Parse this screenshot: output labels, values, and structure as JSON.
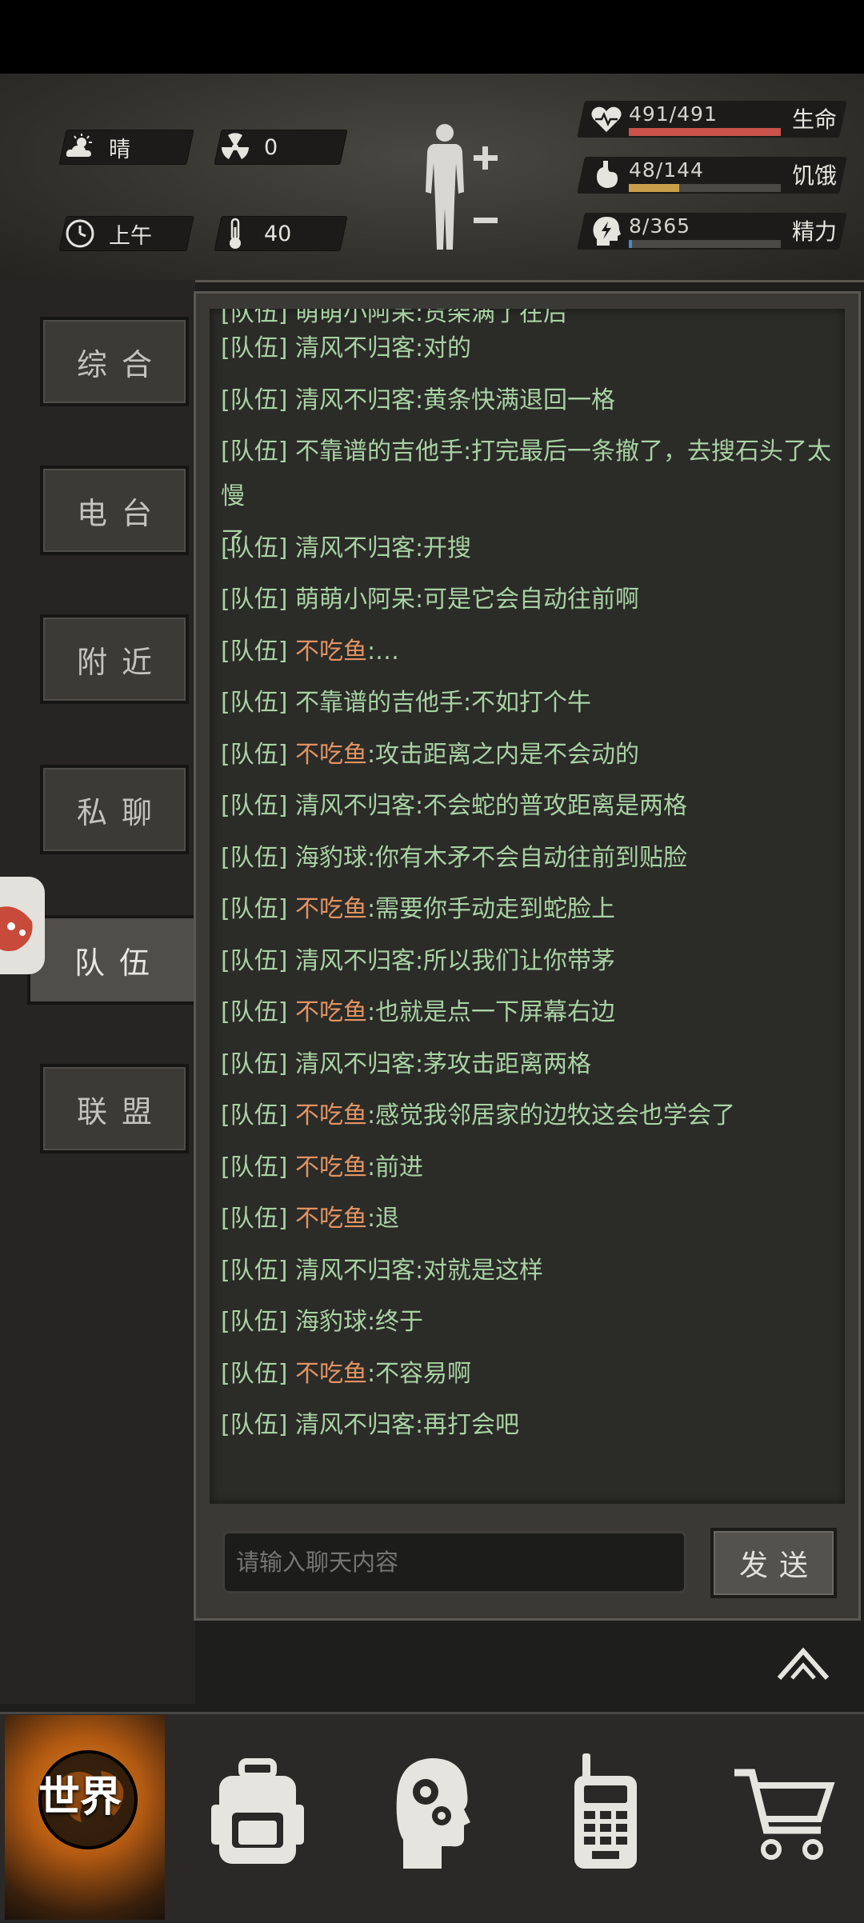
{
  "hud": {
    "weather": "晴",
    "radiation": "0",
    "time_of_day": "上午",
    "temperature": "40",
    "stats": [
      {
        "name": "生命",
        "value": "491/491",
        "fill": 1.0,
        "color": "#c9534a",
        "icon": "heart-pulse-icon"
      },
      {
        "name": "饥饿",
        "value": "48/144",
        "fill": 0.333,
        "color": "#c9a04a",
        "icon": "stomach-icon"
      },
      {
        "name": "精力",
        "value": "8/365",
        "fill": 0.022,
        "color": "#4a86c9",
        "icon": "energy-head-icon"
      }
    ]
  },
  "tabs": [
    {
      "label": "综合",
      "active": false
    },
    {
      "label": "电台",
      "active": false
    },
    {
      "label": "附近",
      "active": false
    },
    {
      "label": "私聊",
      "active": false
    },
    {
      "label": "队伍",
      "active": true
    },
    {
      "label": "联盟",
      "active": false
    }
  ],
  "chat": {
    "partial_top": "[队伍] 萌萌小阿呆:货架满了在后",
    "messages": [
      {
        "channel": "[队伍]",
        "name": "清风不归客",
        "text": ":对的",
        "alt": false
      },
      {
        "channel": "[队伍]",
        "name": "清风不归客",
        "text": ":黄条快满退回一格",
        "alt": false
      },
      {
        "channel": "[队伍]",
        "name": "不靠谱的吉他手",
        "text": ":打完最后一条撤了，去搜石头了太慢",
        "text2": "了",
        "alt": false
      },
      {
        "channel": "[队伍]",
        "name": "清风不归客",
        "text": ":开搜",
        "alt": false
      },
      {
        "channel": "[队伍]",
        "name": "萌萌小阿呆",
        "text": ":可是它会自动往前啊",
        "alt": false
      },
      {
        "channel": "[队伍]",
        "name": "不吃鱼",
        "text": ":…",
        "alt": true
      },
      {
        "channel": "[队伍]",
        "name": "不靠谱的吉他手",
        "text": ":不如打个牛",
        "alt": false
      },
      {
        "channel": "[队伍]",
        "name": "不吃鱼",
        "text": ":攻击距离之内是不会动的",
        "alt": true
      },
      {
        "channel": "[队伍]",
        "name": "清风不归客",
        "text": ":不会蛇的普攻距离是两格",
        "alt": false
      },
      {
        "channel": "[队伍]",
        "name": "海豹球",
        "text": ":你有木矛不会自动往前到贴脸",
        "alt": false
      },
      {
        "channel": "[队伍]",
        "name": "不吃鱼",
        "text": ":需要你手动走到蛇脸上",
        "alt": true
      },
      {
        "channel": "[队伍]",
        "name": "清风不归客",
        "text": ":所以我们让你带茅",
        "alt": false
      },
      {
        "channel": "[队伍]",
        "name": "不吃鱼",
        "text": ":也就是点一下屏幕右边",
        "alt": true
      },
      {
        "channel": "[队伍]",
        "name": "清风不归客",
        "text": ":茅攻击距离两格",
        "alt": false
      },
      {
        "channel": "[队伍]",
        "name": "不吃鱼",
        "text": ":感觉我邻居家的边牧这会也学会了",
        "alt": true
      },
      {
        "channel": "[队伍]",
        "name": "不吃鱼",
        "text": ":前进",
        "alt": true
      },
      {
        "channel": "[队伍]",
        "name": "不吃鱼",
        "text": ":退",
        "alt": true
      },
      {
        "channel": "[队伍]",
        "name": "清风不归客",
        "text": ":对就是这样",
        "alt": false
      },
      {
        "channel": "[队伍]",
        "name": "海豹球",
        "text": ":终于",
        "alt": false
      },
      {
        "channel": "[队伍]",
        "name": "不吃鱼",
        "text": ":不容易啊",
        "alt": true
      },
      {
        "channel": "[队伍]",
        "name": "清风不归客",
        "text": ":再打会吧",
        "alt": false
      }
    ],
    "input_placeholder": "请输入聊天内容",
    "send_label": "发送"
  },
  "bottom_nav": {
    "world_label": "世界",
    "items": [
      "world-globe-icon",
      "backpack-icon",
      "skills-head-icon",
      "walkie-talkie-icon",
      "shop-cart-icon"
    ]
  }
}
